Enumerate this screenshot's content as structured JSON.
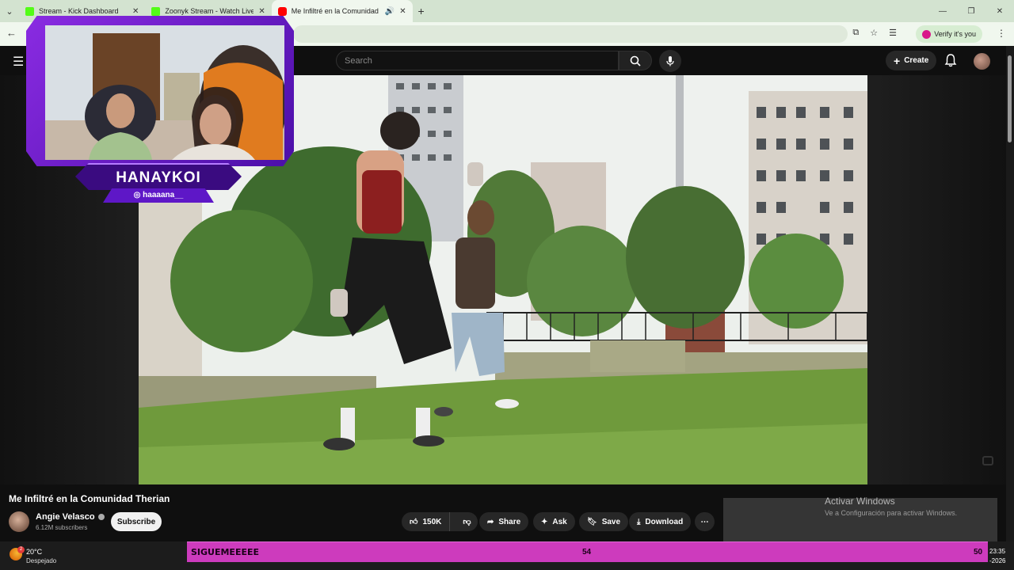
{
  "browser": {
    "tabs": [
      {
        "title": "Stream - Kick Dashboard"
      },
      {
        "title": "Zoonyk Stream - Watch Live on"
      },
      {
        "title": "Me Infiltré en la Comunidad"
      }
    ],
    "verify_label": "Verify it's you"
  },
  "youtube": {
    "search_placeholder": "Search",
    "create_label": "Create"
  },
  "webcam": {
    "name": "HANAYKOI",
    "handle": "haaaana__"
  },
  "video": {
    "title": "Me Infiltré en la Comunidad Therian",
    "channel": "Angie Velasco",
    "subscribers": "6.12M subscribers",
    "subscribe_label": "Subscribe",
    "likes": "150K",
    "share_label": "Share",
    "ask_label": "Ask",
    "save_label": "Save",
    "download_label": "Download"
  },
  "windows_activation": {
    "title": "Activar Windows",
    "subtitle": "Ve a Configuración para activar Windows."
  },
  "overlay": {
    "text": "SIGUEMEEEEE",
    "count_mid": "54",
    "count_right": "50"
  },
  "taskbar": {
    "weather_badge": "2",
    "temperature": "20°C",
    "condition": "Despejado",
    "time": "23:35",
    "date": "-2026"
  }
}
